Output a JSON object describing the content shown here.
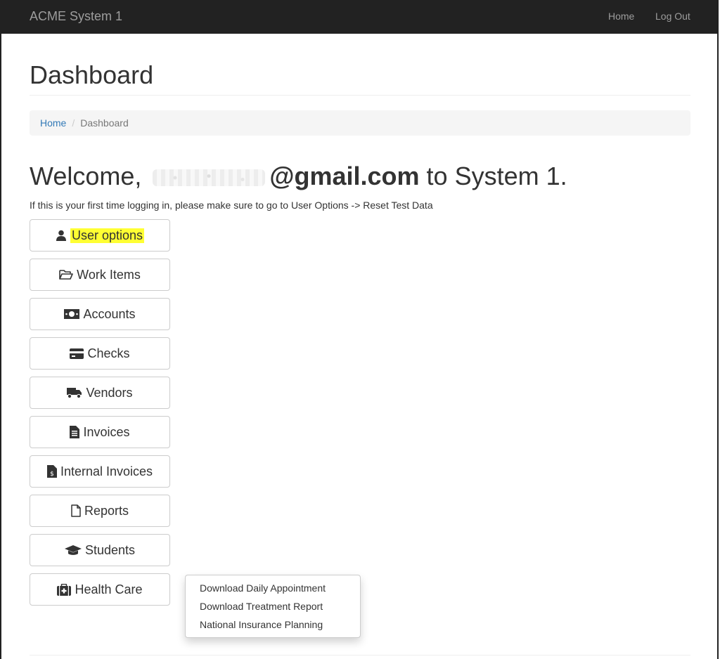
{
  "navbar": {
    "brand": "ACME System 1",
    "home": "Home",
    "logout": "Log Out"
  },
  "page": {
    "title": "Dashboard"
  },
  "breadcrumb": {
    "home": "Home",
    "current": "Dashboard"
  },
  "welcome": {
    "prefix": "Welcome,",
    "email": "@gmail.com",
    "suffix": " to System 1."
  },
  "info": "If this is your first time logging in, please make sure to go to User Options -> Reset Test Data",
  "menu": {
    "user_options": "User options",
    "work_items": "Work Items",
    "accounts": "Accounts",
    "checks": "Checks",
    "vendors": "Vendors",
    "invoices": "Invoices",
    "internal_invoices": "Internal Invoices",
    "reports": "Reports",
    "students": "Students",
    "health_care": "Health Care"
  },
  "dropdown": {
    "items": [
      "Download Daily Appointment",
      "Download Treatment Report",
      "National Insurance Planning"
    ]
  },
  "colors": {
    "navbar_bg": "#222222",
    "link": "#337ab7",
    "highlight": "#ffff33"
  },
  "icons": {
    "user_options": "user-icon",
    "work_items": "folder-open-icon",
    "accounts": "money-bill-icon",
    "checks": "credit-card-icon",
    "vendors": "truck-icon",
    "invoices": "invoice-icon",
    "internal_invoices": "invoice-dollar-icon",
    "reports": "file-icon",
    "students": "graduation-cap-icon",
    "health_care": "medkit-icon"
  }
}
